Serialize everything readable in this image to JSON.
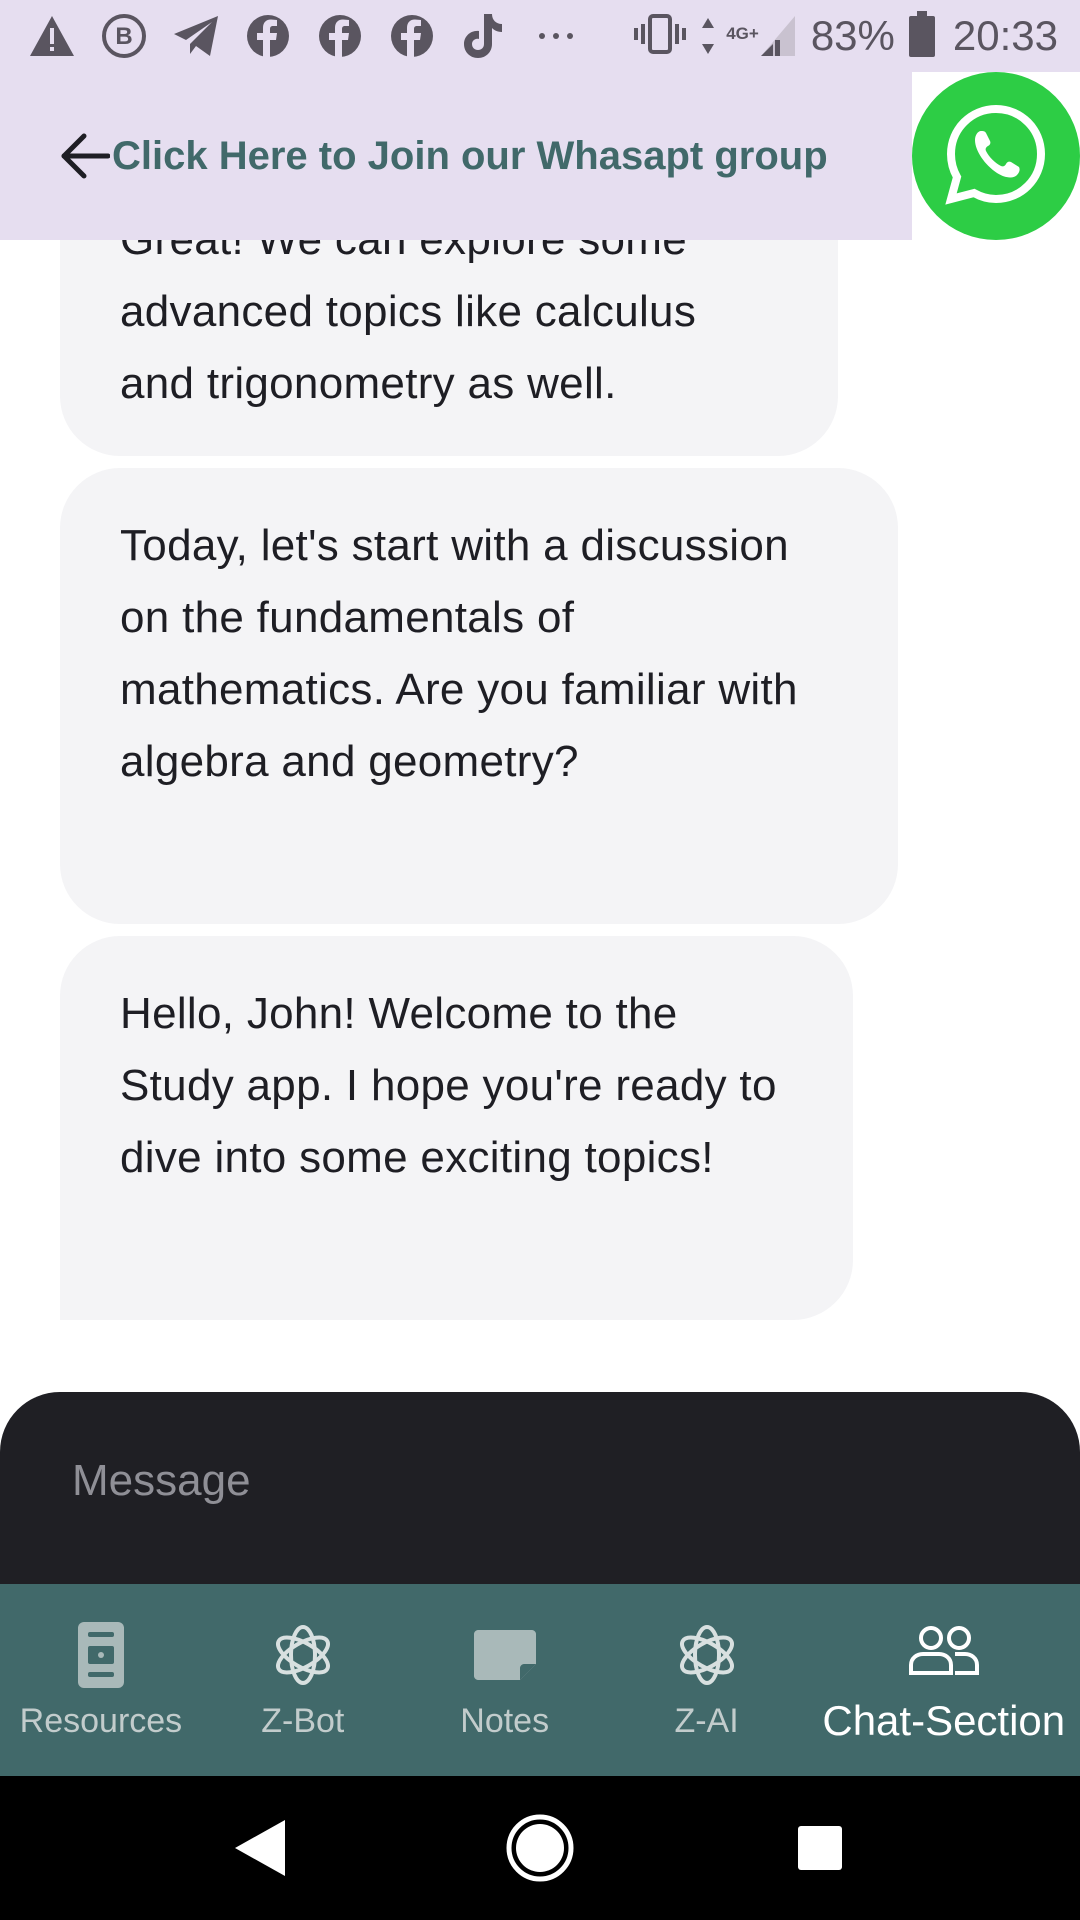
{
  "status_bar": {
    "battery": "83%",
    "time": "20:33",
    "network": "4G+",
    "icons": [
      "warning-icon",
      "b-badge-icon",
      "telegram-icon",
      "facebook-icon",
      "facebook-icon",
      "facebook-icon",
      "tiktok-icon",
      "more-icon",
      "vibrate-icon",
      "signal-icon",
      "battery-icon"
    ]
  },
  "header": {
    "title": "Click Here to Join our Whasapt group",
    "back_icon": "arrow-left-icon",
    "whatsapp_icon": "whatsapp-icon",
    "whatsapp_color": "#2dcd45",
    "title_color": "#41696a"
  },
  "messages": [
    {
      "text": "Great! We can explore some advanced topics like calculus and trigonometry as well."
    },
    {
      "text": "Today, let's start with a discussion on the fundamentals of mathematics. Are you familiar with algebra and geometry?"
    },
    {
      "text": "Hello, John! Welcome to the Study app. I hope you're ready to dive into some exciting topics!"
    }
  ],
  "composer": {
    "placeholder": "Message"
  },
  "bottom_nav": {
    "items": [
      {
        "label": "Resources",
        "icon": "resources-icon",
        "active": false
      },
      {
        "label": "Z-Bot",
        "icon": "openai-icon",
        "active": false
      },
      {
        "label": "Notes",
        "icon": "note-icon",
        "active": false
      },
      {
        "label": "Z-AI",
        "icon": "openai-icon",
        "active": false
      },
      {
        "label": "Chat-Section",
        "icon": "people-icon",
        "active": true
      }
    ],
    "background_color": "#41696a"
  },
  "system_nav": {
    "icons": [
      "back-triangle-icon",
      "home-circle-icon",
      "recents-square-icon"
    ]
  }
}
